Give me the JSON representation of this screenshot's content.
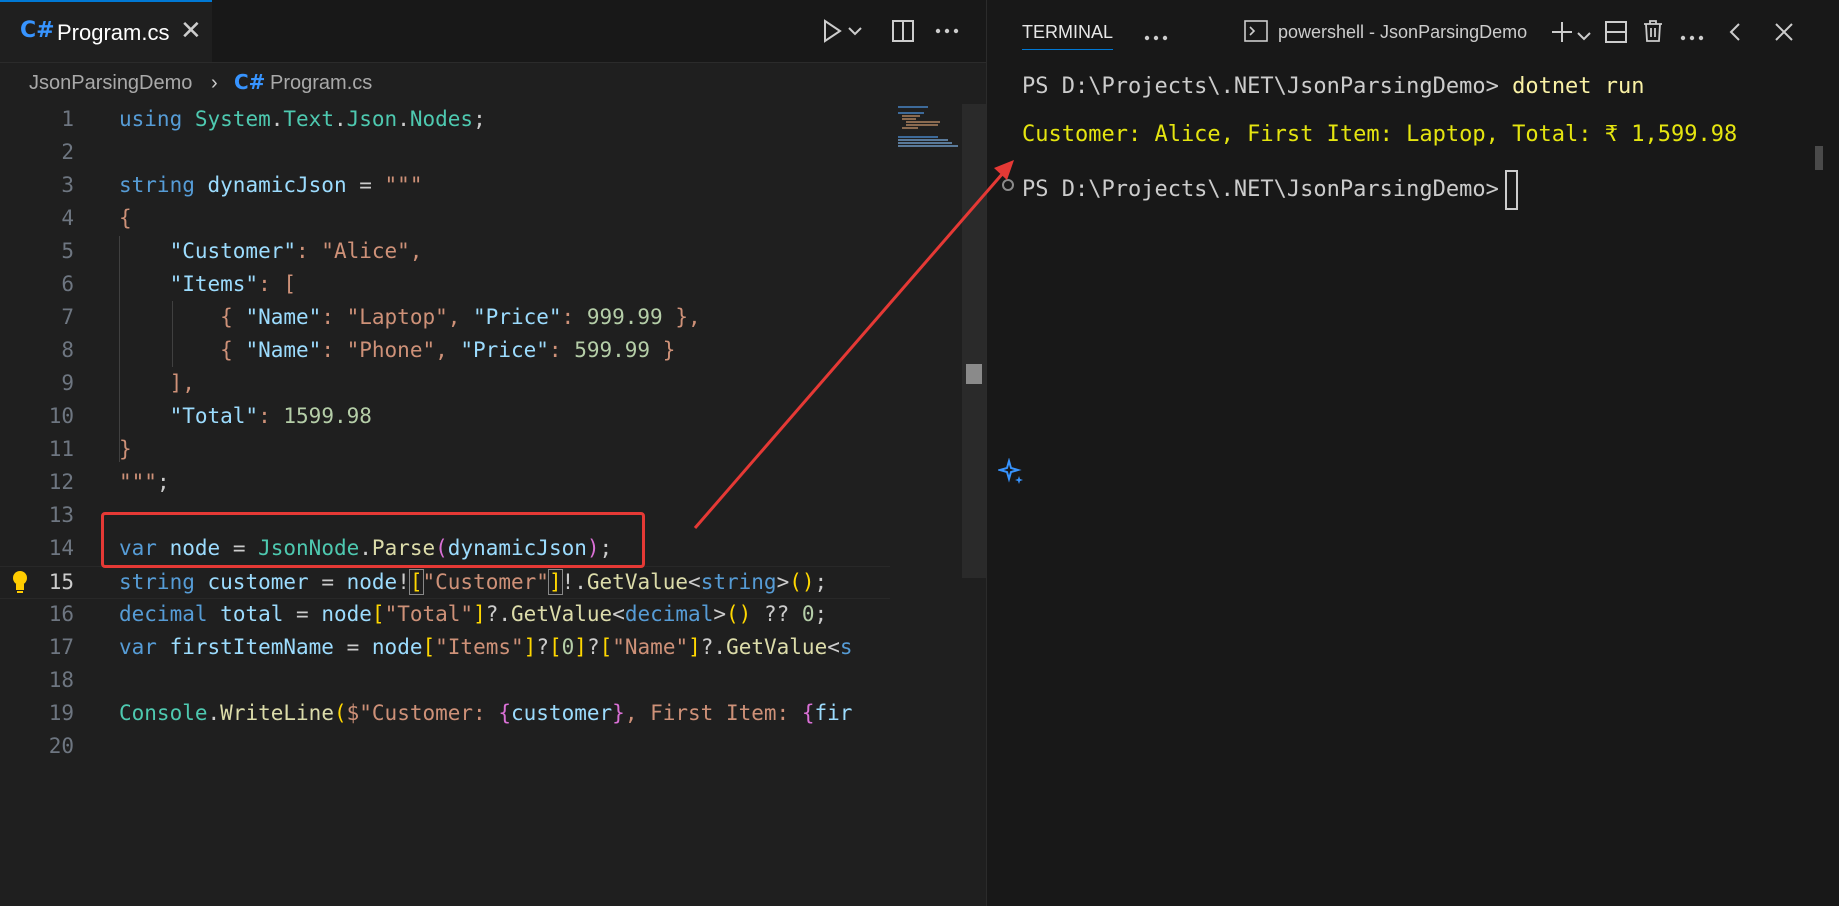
{
  "editor": {
    "tab": {
      "icon": "C#",
      "label": "Program.cs",
      "close": "✕"
    },
    "breadcrumb": {
      "project": "JsonParsingDemo",
      "separator": "›",
      "icon": "C#",
      "file": "Program.cs"
    },
    "lines": [
      {
        "num": "1"
      },
      {
        "num": "2"
      },
      {
        "num": "3"
      },
      {
        "num": "4"
      },
      {
        "num": "5"
      },
      {
        "num": "6"
      },
      {
        "num": "7"
      },
      {
        "num": "8"
      },
      {
        "num": "9"
      },
      {
        "num": "10"
      },
      {
        "num": "11"
      },
      {
        "num": "12"
      },
      {
        "num": "13"
      },
      {
        "num": "14"
      },
      {
        "num": "15"
      },
      {
        "num": "16"
      },
      {
        "num": "17"
      },
      {
        "num": "18"
      },
      {
        "num": "19"
      },
      {
        "num": "20"
      }
    ]
  },
  "terminal": {
    "tab_label": "TERMINAL",
    "shell_label": "powershell - JsonParsingDemo",
    "prompt": "PS D:\\Projects\\.NET\\JsonParsingDemo>",
    "command": "dotnet run",
    "output": "Customer: Alice, First Item: Laptop, Total: ₹ 1,599.98"
  },
  "colors": {
    "accent": "#0078d4",
    "annotation": "#e53935",
    "output": "#e5e510",
    "command": "#f9f1a5"
  }
}
